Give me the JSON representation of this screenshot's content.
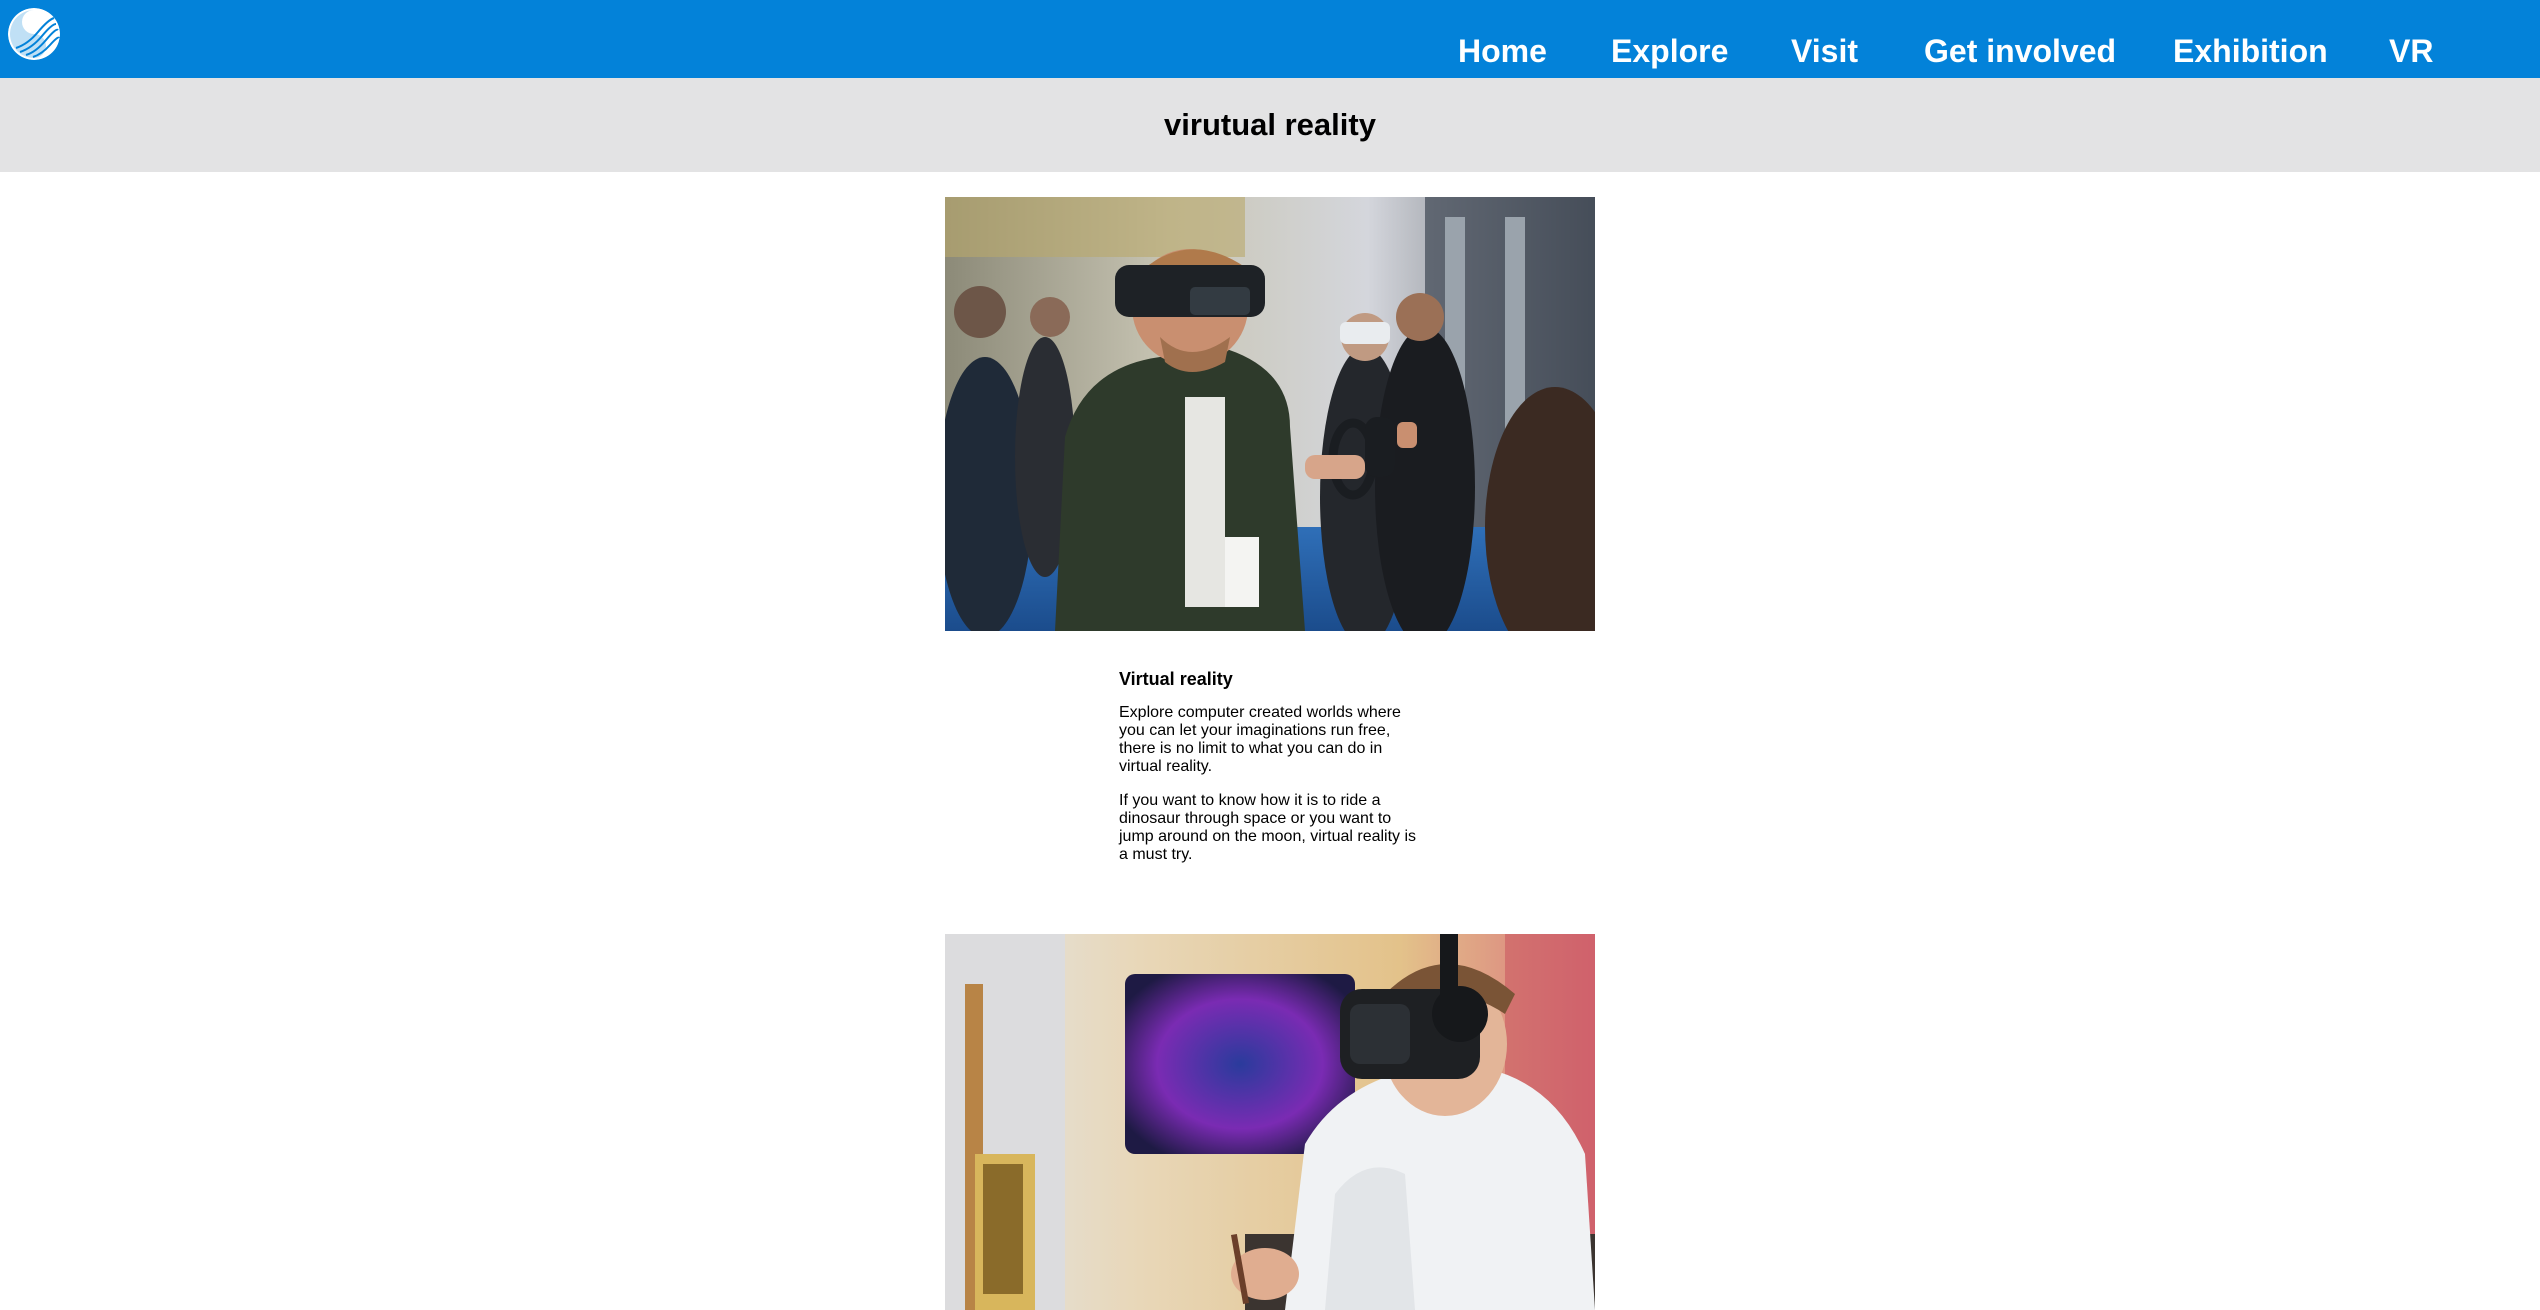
{
  "header": {
    "logo": "site-logo",
    "nav": [
      {
        "label": "Home"
      },
      {
        "label": "Explore"
      },
      {
        "label": "Visit"
      },
      {
        "label": "Get involved"
      },
      {
        "label": "Exhibition"
      },
      {
        "label": "VR"
      }
    ]
  },
  "page": {
    "title": "virutual reality"
  },
  "article": {
    "heading": "Virtual reality",
    "paragraphs": [
      "Explore computer created worlds where you can let your imaginations run free, there is no limit to what you can do in virtual reality.",
      "If you want to know how it is to ride a dinosaur through space or you want to jump around on the moon, virtual reality is a must try."
    ]
  },
  "colors": {
    "header_bg": "#0382d9",
    "title_band_bg": "#e3e3e4",
    "nav_text": "#ffffff"
  }
}
